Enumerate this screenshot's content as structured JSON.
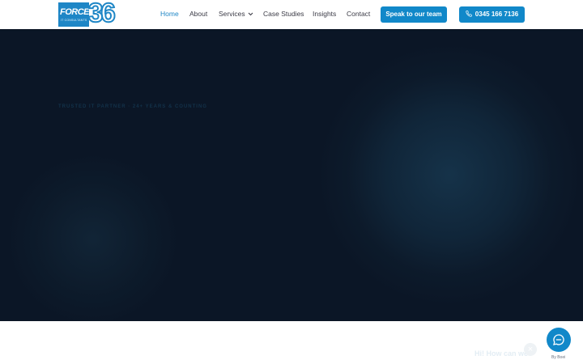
{
  "brand": {
    "logo_word": "FORCE",
    "logo_number": "36",
    "logo_tagline": "IT CONSULTANTS"
  },
  "nav": {
    "items": [
      {
        "label": "Home",
        "active": true
      },
      {
        "label": "About"
      },
      {
        "label": "Services"
      },
      {
        "label": "Case Studies"
      },
      {
        "label": "Insights"
      },
      {
        "label": "Contact"
      }
    ],
    "cta_label": "Speak to our team",
    "phone_label": "0345 166 7136"
  },
  "hero": {
    "eyebrow": "TRUSTED IT PARTNER · 24+ YEARS & COUNTING"
  },
  "chat": {
    "message": "Hi! How can we",
    "close_symbol": "×",
    "by": "By Boei"
  },
  "colors": {
    "accent": "#1188c9",
    "hero_bg": "#0b1626",
    "nav_text": "#3b3b46"
  }
}
